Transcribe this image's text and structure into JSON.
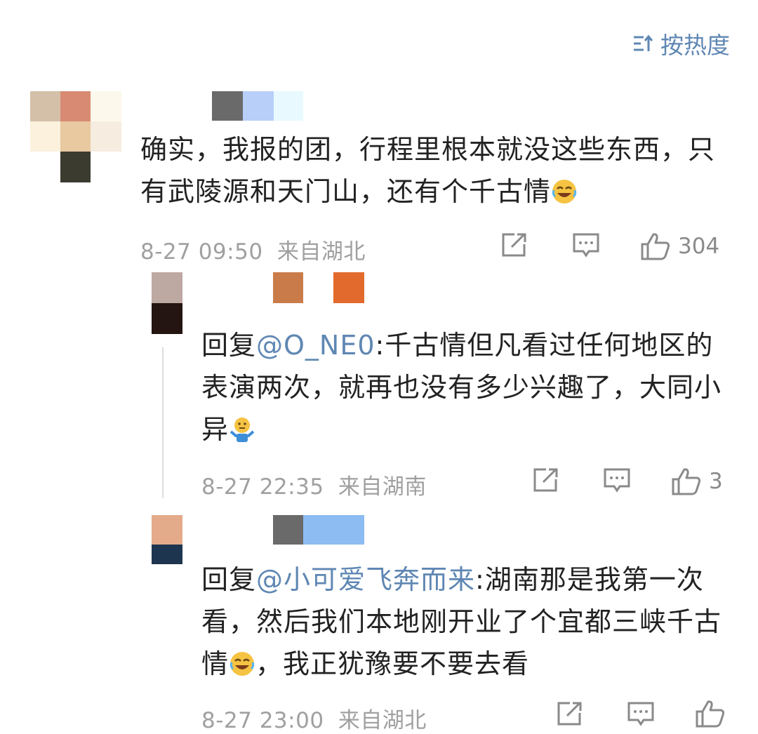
{
  "sort": {
    "label": "按热度",
    "icon": "sort-icon"
  },
  "comments": [
    {
      "text": "确实，我报的团，行程里根本就没这些东西，只有武陵源和天门山，还有个千古情",
      "emoji": "laugh-tears-emoji",
      "date": "8-27 09:50",
      "location": "来自湖北",
      "likes": "304"
    },
    {
      "reply_prefix": "回复",
      "mention": "@O_NE0",
      "text": ":千古情但凡看过任何地区的表演两次，就再也没有多少兴趣了，大同小异",
      "emoji": "shrug-emoji",
      "date": "8-27 22:35",
      "location": "来自湖南",
      "likes": "3"
    },
    {
      "reply_prefix": "回复",
      "mention": "@小可爱飞奔而来",
      "text": ":湖南那是我第一次看，然后我们本地刚开业了个宜都三峡千古情",
      "text_after": "，我正犹豫要不要去看",
      "emoji": "laugh-tears-emoji",
      "date": "8-27 23:00",
      "location": "来自湖北",
      "likes": ""
    }
  ],
  "icons": {
    "share": "share-icon",
    "reply": "comment-icon",
    "like": "thumbs-up-icon"
  },
  "colors": {
    "link": "#5f87b3",
    "meta": "#a0a0a0"
  }
}
